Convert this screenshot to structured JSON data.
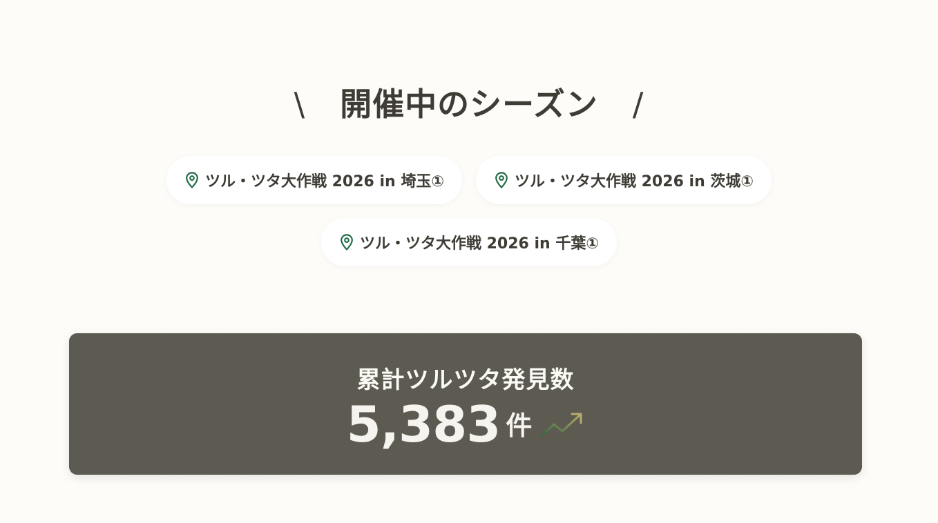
{
  "heading": {
    "left_mark": "\\",
    "title": "開催中のシーズン",
    "right_mark": "/"
  },
  "seasons": [
    {
      "label": "ツル・ツタ大作戦 2026 in 埼玉①",
      "icon": "location-pin-icon"
    },
    {
      "label": "ツル・ツタ大作戦 2026 in 茨城①",
      "icon": "location-pin-icon"
    },
    {
      "label": "ツル・ツタ大作戦 2026 in 千葉①",
      "icon": "location-pin-icon"
    }
  ],
  "counter": {
    "title": "累計ツルツタ発見数",
    "value": "5,383",
    "unit": "件",
    "icon": "trend-up-icon"
  },
  "colors": {
    "background": "#fdfcf8",
    "text": "#3f3c35",
    "pin": "#1f6b45",
    "counter_bg": "#5c5a51",
    "counter_text": "#f6f4ee",
    "trend_start": "#2e6b3d",
    "trend_end": "#b8ab6e"
  }
}
